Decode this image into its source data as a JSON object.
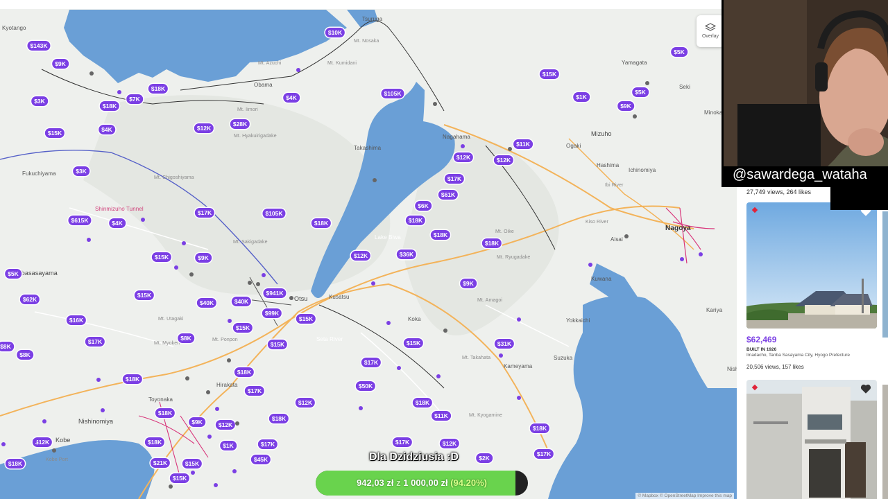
{
  "map": {
    "overlay_label": "Overlay",
    "attribution": "© Mapbox © OpenStreetMap Improve this map",
    "colors": {
      "accent": "#7b3fe4",
      "water": "#6a9fd6",
      "land": "#eef0ed"
    },
    "places": [
      {
        "t": "Kyotango"
      },
      {
        "t": "Tsuruga"
      },
      {
        "t": "Obama"
      },
      {
        "t": "Mt. Nosaka"
      },
      {
        "t": "Mt. Kumidani"
      },
      {
        "t": "Mt. Azuchi"
      },
      {
        "t": "Mt. Iimori"
      },
      {
        "t": "Mt. Hyakuirigadake"
      },
      {
        "t": "Fukuchiyama"
      },
      {
        "t": "Shinmizuho Tunnel"
      },
      {
        "t": "Mt. Chigoshiyama"
      },
      {
        "t": "Tanbasasayama"
      },
      {
        "t": "Mt. Sakigadake"
      },
      {
        "t": "Mt. Utagaki"
      },
      {
        "t": "Mt. Myoken"
      },
      {
        "t": "Mt. Ponpon"
      },
      {
        "t": "Toyonaka"
      },
      {
        "t": "Nishinomiya"
      },
      {
        "t": "Kobe"
      },
      {
        "t": "Kobe Port"
      },
      {
        "t": "Takashima"
      },
      {
        "t": "Nagahama"
      },
      {
        "t": "Otsu"
      },
      {
        "t": "Kusatsu"
      },
      {
        "t": "Koka"
      },
      {
        "t": "Hirakata"
      },
      {
        "t": "Mt. Amagoi"
      },
      {
        "t": "Mt. Ryugadake"
      },
      {
        "t": "Mt. Oike"
      },
      {
        "t": "Mt. Takahata"
      },
      {
        "t": "Kameyama"
      },
      {
        "t": "Mt. Kyogamine"
      },
      {
        "t": "Suzuka"
      },
      {
        "t": "Yokkaichi"
      },
      {
        "t": "Kuwana"
      },
      {
        "t": "Aisai"
      },
      {
        "t": "Nagoya"
      },
      {
        "t": "Kariya"
      },
      {
        "t": "Ichinomiya"
      },
      {
        "t": "Hashima"
      },
      {
        "t": "Ogaki"
      },
      {
        "t": "Mizuho"
      },
      {
        "t": "Yamagata"
      },
      {
        "t": "Seki"
      },
      {
        "t": "Minokamo"
      },
      {
        "t": "Ibi River"
      },
      {
        "t": "Kiso River"
      },
      {
        "t": "Seta River"
      },
      {
        "t": "Lake Biwa"
      },
      {
        "t": "Nishiki"
      }
    ],
    "pins": [
      {
        "p": "$143K"
      },
      {
        "p": "$9K"
      },
      {
        "p": "$3K"
      },
      {
        "p": "$18K"
      },
      {
        "p": "$7K"
      },
      {
        "p": "$18K"
      },
      {
        "p": "$4K"
      },
      {
        "p": "$15K"
      },
      {
        "p": "$3K"
      },
      {
        "p": "$12K"
      },
      {
        "p": "$28K"
      },
      {
        "p": "$10K"
      },
      {
        "p": "$105K"
      },
      {
        "p": "$4K"
      },
      {
        "p": "$615K"
      },
      {
        "p": "$4K"
      },
      {
        "p": "$17K"
      },
      {
        "p": "$105K"
      },
      {
        "p": "$18K"
      },
      {
        "p": "$15K"
      },
      {
        "p": "$9K"
      },
      {
        "p": "$5K"
      },
      {
        "p": "$62K"
      },
      {
        "p": "$15K"
      },
      {
        "p": "$40K"
      },
      {
        "p": "$40K"
      },
      {
        "p": "$941K"
      },
      {
        "p": "$99K"
      },
      {
        "p": "$15K"
      },
      {
        "p": "$15K"
      },
      {
        "p": "$16K"
      },
      {
        "p": "$17K"
      },
      {
        "p": "$8K"
      },
      {
        "p": "$18K"
      },
      {
        "p": "$15K"
      },
      {
        "p": "$8K"
      },
      {
        "p": "$18K"
      },
      {
        "p": "$9K"
      },
      {
        "p": "$12K"
      },
      {
        "p": "$18K"
      },
      {
        "p": "$18K"
      },
      {
        "p": "$1K"
      },
      {
        "p": "$17K"
      },
      {
        "p": "$12K"
      },
      {
        "p": "$21K"
      },
      {
        "p": "$15K"
      },
      {
        "p": "$45K"
      },
      {
        "p": "$15K"
      },
      {
        "p": "$17K"
      },
      {
        "p": "$12K"
      },
      {
        "p": "$18K"
      },
      {
        "p": "$18K"
      },
      {
        "p": "$17K"
      },
      {
        "p": "$61K"
      },
      {
        "p": "$6K"
      },
      {
        "p": "$18K"
      },
      {
        "p": "$18K"
      },
      {
        "p": "$36K"
      },
      {
        "p": "$12K"
      },
      {
        "p": "$18K"
      },
      {
        "p": "$9K"
      },
      {
        "p": "$15K"
      },
      {
        "p": "$17K"
      },
      {
        "p": "$50K"
      },
      {
        "p": "$12K"
      },
      {
        "p": "$18K"
      },
      {
        "p": "$11K"
      },
      {
        "p": "$31K"
      },
      {
        "p": "$17K"
      },
      {
        "p": "$12K"
      },
      {
        "p": "$2K"
      },
      {
        "p": "$18K"
      },
      {
        "p": "$17K"
      },
      {
        "p": "$11K"
      },
      {
        "p": "$12K"
      },
      {
        "p": "$15K"
      },
      {
        "p": "$1K"
      },
      {
        "p": "$5K"
      },
      {
        "p": "$9K"
      },
      {
        "p": "$5K"
      },
      {
        "p": "$8K"
      }
    ]
  },
  "overlay": {
    "handle": "@sawardega_wataha"
  },
  "listings": {
    "top_stats": "27,749 views, 264 likes",
    "cards": [
      {
        "price": "$62,469",
        "built": "BUILT IN 1926",
        "address": "Imadacho, Tanba Sasayama City, Hyogo Prefecture",
        "views": "20,506 views, 157 likes"
      },
      {
        "price": "",
        "built": "",
        "address": "",
        "views": ""
      }
    ]
  },
  "donation": {
    "title": "Dla Dzidziusia :D",
    "current": "942,03 zł",
    "sep": "z",
    "goal": "1 000,00 zł",
    "percent_text": "(94.20%)",
    "progress": 0.942
  }
}
